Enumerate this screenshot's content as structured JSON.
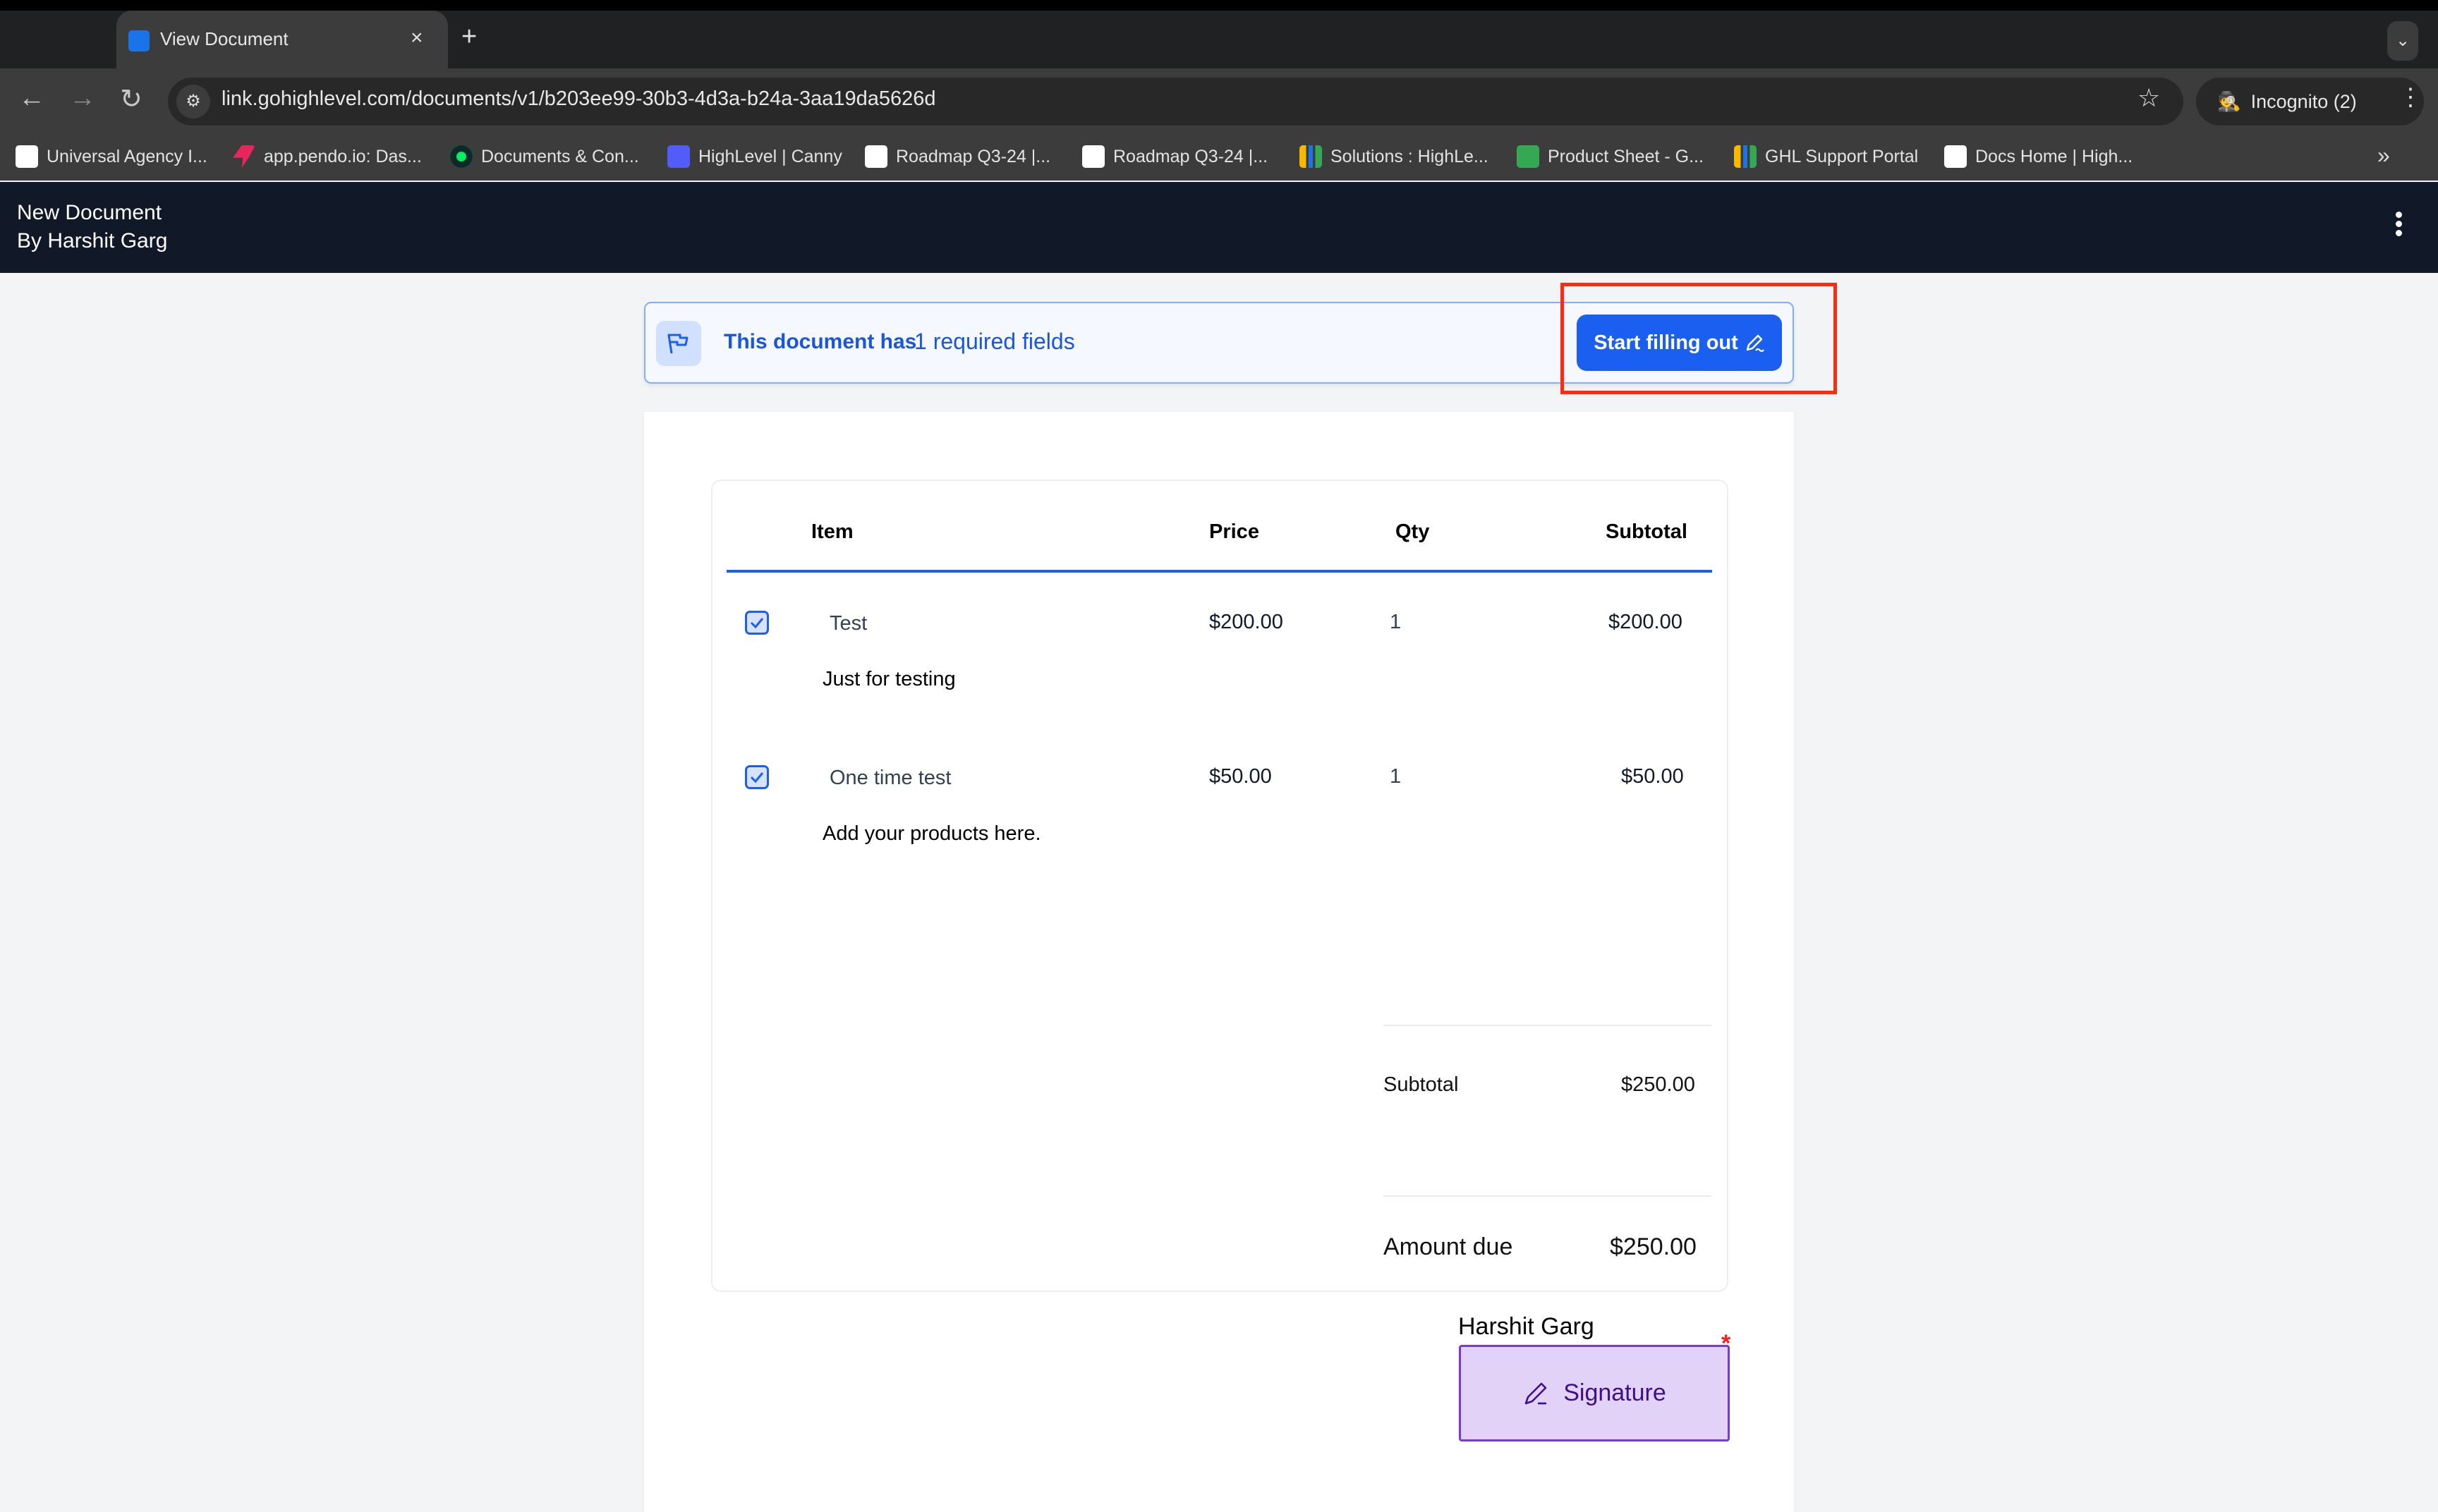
{
  "browser": {
    "tab": {
      "title": "View Document",
      "close": "×"
    },
    "new_tab": "+",
    "tab_search": "⌄",
    "nav": {
      "back": "←",
      "forward": "→",
      "reload": "↻"
    },
    "url": "link.gohighlevel.com/documents/v1/b203ee99-30b3-4d3a-b24a-3aa19da5626d",
    "incognito_label": "Incognito (2)",
    "menu": "⋮",
    "bookmarks": [
      {
        "label": "Universal Agency I...",
        "color": "#ffffff"
      },
      {
        "label": "app.pendo.io: Das...",
        "color": "#e8265e"
      },
      {
        "label": "Documents & Con...",
        "color": "#0d2a28"
      },
      {
        "label": "HighLevel | Canny",
        "color": "#525df9"
      },
      {
        "label": "Roadmap Q3-24 |...",
        "color": "#ffffff"
      },
      {
        "label": "Roadmap Q3-24 |...",
        "color": "#ffffff"
      },
      {
        "label": "Solutions : HighLe...",
        "color": "#3c3c3c"
      },
      {
        "label": "Product Sheet - G...",
        "color": "#34a853"
      },
      {
        "label": "GHL Support Portal",
        "color": "#3c3c3c"
      },
      {
        "label": "Docs Home | High...",
        "color": "#ffffff"
      }
    ],
    "bookmarks_more": "»"
  },
  "app_header": {
    "title": "New Document",
    "author": "By Harshit Garg"
  },
  "banner": {
    "text": "This document has",
    "count_text": "1 required fields",
    "button_label": "Start filling out"
  },
  "table": {
    "headers": {
      "item": "Item",
      "price": "Price",
      "qty": "Qty",
      "subtotal": "Subtotal"
    },
    "rows": [
      {
        "checked": true,
        "name": "Test",
        "description": "Just for testing",
        "price": "$200.00",
        "qty": "1",
        "subtotal": "$200.00"
      },
      {
        "checked": true,
        "name": "One time test",
        "description": "Add your products here.",
        "price": "$50.00",
        "qty": "1",
        "subtotal": "$50.00"
      }
    ],
    "summary": {
      "subtotal_label": "Subtotal",
      "subtotal_value": "$250.00",
      "amount_due_label": "Amount due",
      "amount_due_value": "$250.00"
    }
  },
  "signature": {
    "signer": "Harshit Garg",
    "label": "Signature",
    "required_marker": "*"
  },
  "colors": {
    "primary": "#1a5ff0",
    "header_bg": "#111827",
    "signature_bg": "#e3d2f8",
    "signature_border": "#7a3bd4",
    "highlight": "#ff2a12"
  }
}
